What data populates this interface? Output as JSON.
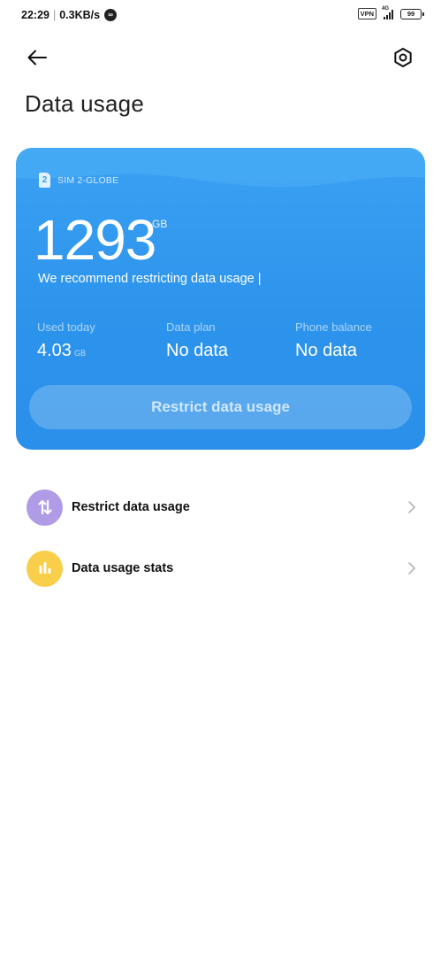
{
  "status_bar": {
    "time": "22:29",
    "speed": "0.3KB/s",
    "network_type": "4G",
    "vpn_label": "VPN",
    "battery": "99"
  },
  "header": {
    "title": "Data usage"
  },
  "card": {
    "sim_slot": "2",
    "sim_name": "SIM 2-GLOBE",
    "big_number": "1293",
    "big_unit": "GB",
    "recommend_text": "We recommend restricting data usage |",
    "stats": [
      {
        "label": "Used today",
        "value": "4.03",
        "unit": "GB"
      },
      {
        "label": "Data plan",
        "value": "No data",
        "unit": ""
      },
      {
        "label": "Phone balance",
        "value": "No data",
        "unit": ""
      }
    ],
    "button_label": "Restrict data usage"
  },
  "menu": [
    {
      "label": "Restrict data usage",
      "icon": "restrict-arrows-icon",
      "color": "#b09ce6"
    },
    {
      "label": "Data usage stats",
      "icon": "bar-chart-icon",
      "color": "#f8ce4a"
    }
  ],
  "colors": {
    "card_blue": "#2d94ec",
    "restrict_icon": "#b09ce6",
    "stats_icon": "#f8ce4a"
  }
}
